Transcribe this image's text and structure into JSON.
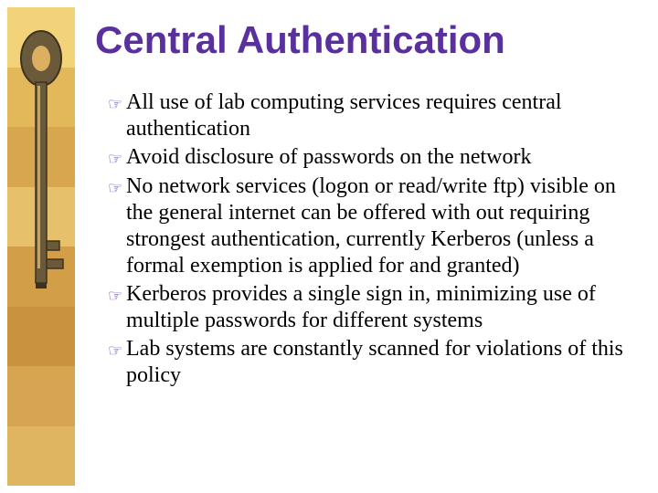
{
  "title": "Central Authentication",
  "bullets": {
    "b0": "All use of lab computing services requires central authentication",
    "b1": "Avoid disclosure of passwords on the network",
    "b2": "No network services (logon or read/write ftp) visible on the general internet can be offered with out requiring strongest authentication, currently Kerberos (unless a formal exemption is applied for and granted)",
    "b3": "Kerberos provides a single sign in, minimizing use of multiple passwords for different systems",
    "b4": "Lab systems are constantly scanned for violations of this policy"
  },
  "bullet_glyph": "☞",
  "side_strip_colors": [
    "#f2d37a",
    "#e2b85a",
    "#d7a64e",
    "#e6c06a",
    "#d39e48",
    "#c9923f",
    "#d6a552",
    "#e0b560"
  ]
}
